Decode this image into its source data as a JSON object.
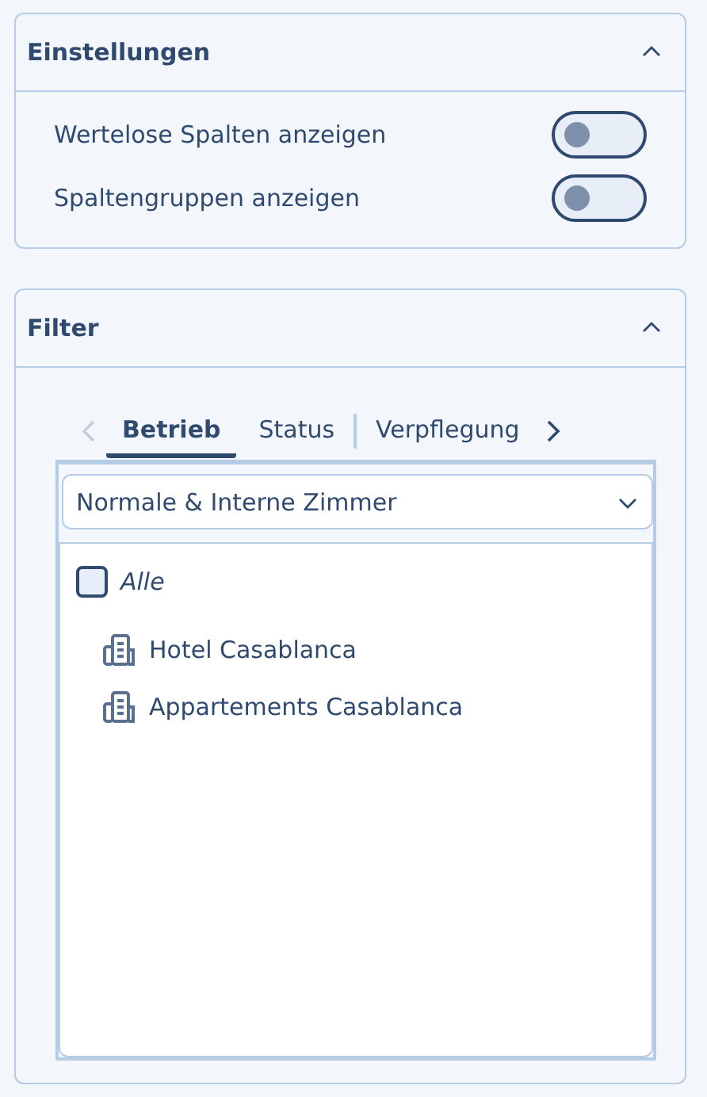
{
  "settings": {
    "title": "Einstellungen",
    "expanded": true,
    "toggles": [
      {
        "label": "Wertelose Spalten anzeigen",
        "on": false
      },
      {
        "label": "Spaltengruppen anzeigen",
        "on": false
      }
    ]
  },
  "filter": {
    "title": "Filter",
    "expanded": true,
    "tabs": [
      {
        "label": "Betrieb",
        "selected": true
      },
      {
        "label": "Status",
        "selected": false
      },
      {
        "label": "Verpflegung",
        "selected": false
      }
    ],
    "dropdown": {
      "value": "Normale & Interne Zimmer"
    },
    "all": {
      "label": "Alle",
      "checked": false
    },
    "items": [
      "Hotel Casablanca",
      "Appartements Casablanca"
    ]
  }
}
